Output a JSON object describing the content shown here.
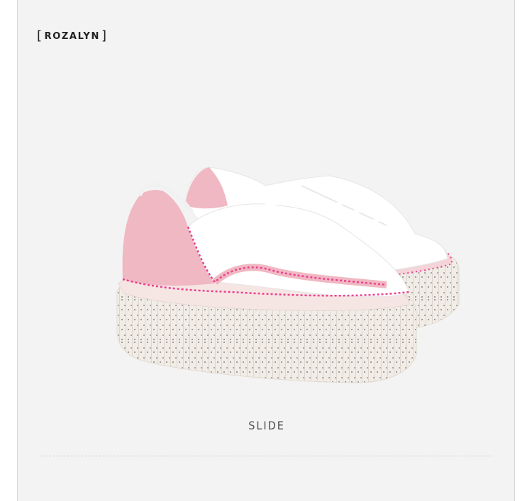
{
  "brand": {
    "logo_text": "ROZALYN",
    "bracket_left": "[",
    "bracket_right": "]"
  },
  "product": {
    "image_icon": "pink-platform-sneakers-image"
  },
  "caption": "SLIDE",
  "colors": {
    "background": "#f3f3f3",
    "suede_pink": "#f0b8c2",
    "stitch_pink": "#ee3f8e",
    "leather_white": "#ffffff",
    "sole": "#efeae4"
  }
}
